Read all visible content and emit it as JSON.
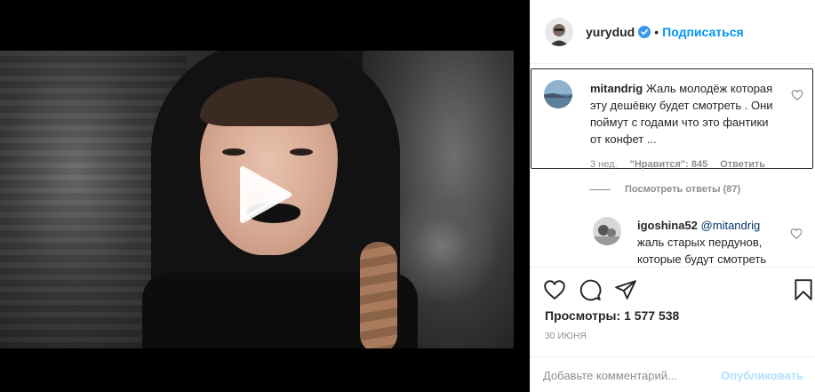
{
  "post": {
    "username": "yurydud",
    "verified": true,
    "separator": "•",
    "follow_label": "Подписаться"
  },
  "comments": [
    {
      "username": "mitandrig",
      "text": "Жаль молодёж которая эту дешёвку будет смотреть . Они поймут с годами что это фантики от конфет ...",
      "time": "3 нед.",
      "likes_label": "\"Нравится\": 845",
      "reply_label": "Ответить",
      "view_replies_label": "Посмотреть ответы (87)"
    }
  ],
  "replies": [
    {
      "username": "igoshina52",
      "mention": "@mitandrig",
      "text": "жаль старых пердунов, которые будут смотреть"
    }
  ],
  "actions": {
    "views_label": "Просмотры:",
    "views_count": "1 577 538",
    "date": "30 июня"
  },
  "add_comment": {
    "placeholder": "Добавьте комментарий...",
    "publish_label": "Опубликовать"
  },
  "icons": {
    "play": "play-icon",
    "like": "heart-icon",
    "comment": "comment-icon",
    "share": "share-icon",
    "save": "bookmark-icon",
    "verified": "verified-badge-icon"
  },
  "colors": {
    "accent": "#0095f6",
    "verified": "#3897f0",
    "publish_disabled": "#b2dffc",
    "text_primary": "#262626",
    "text_secondary": "#8e8e8e"
  }
}
